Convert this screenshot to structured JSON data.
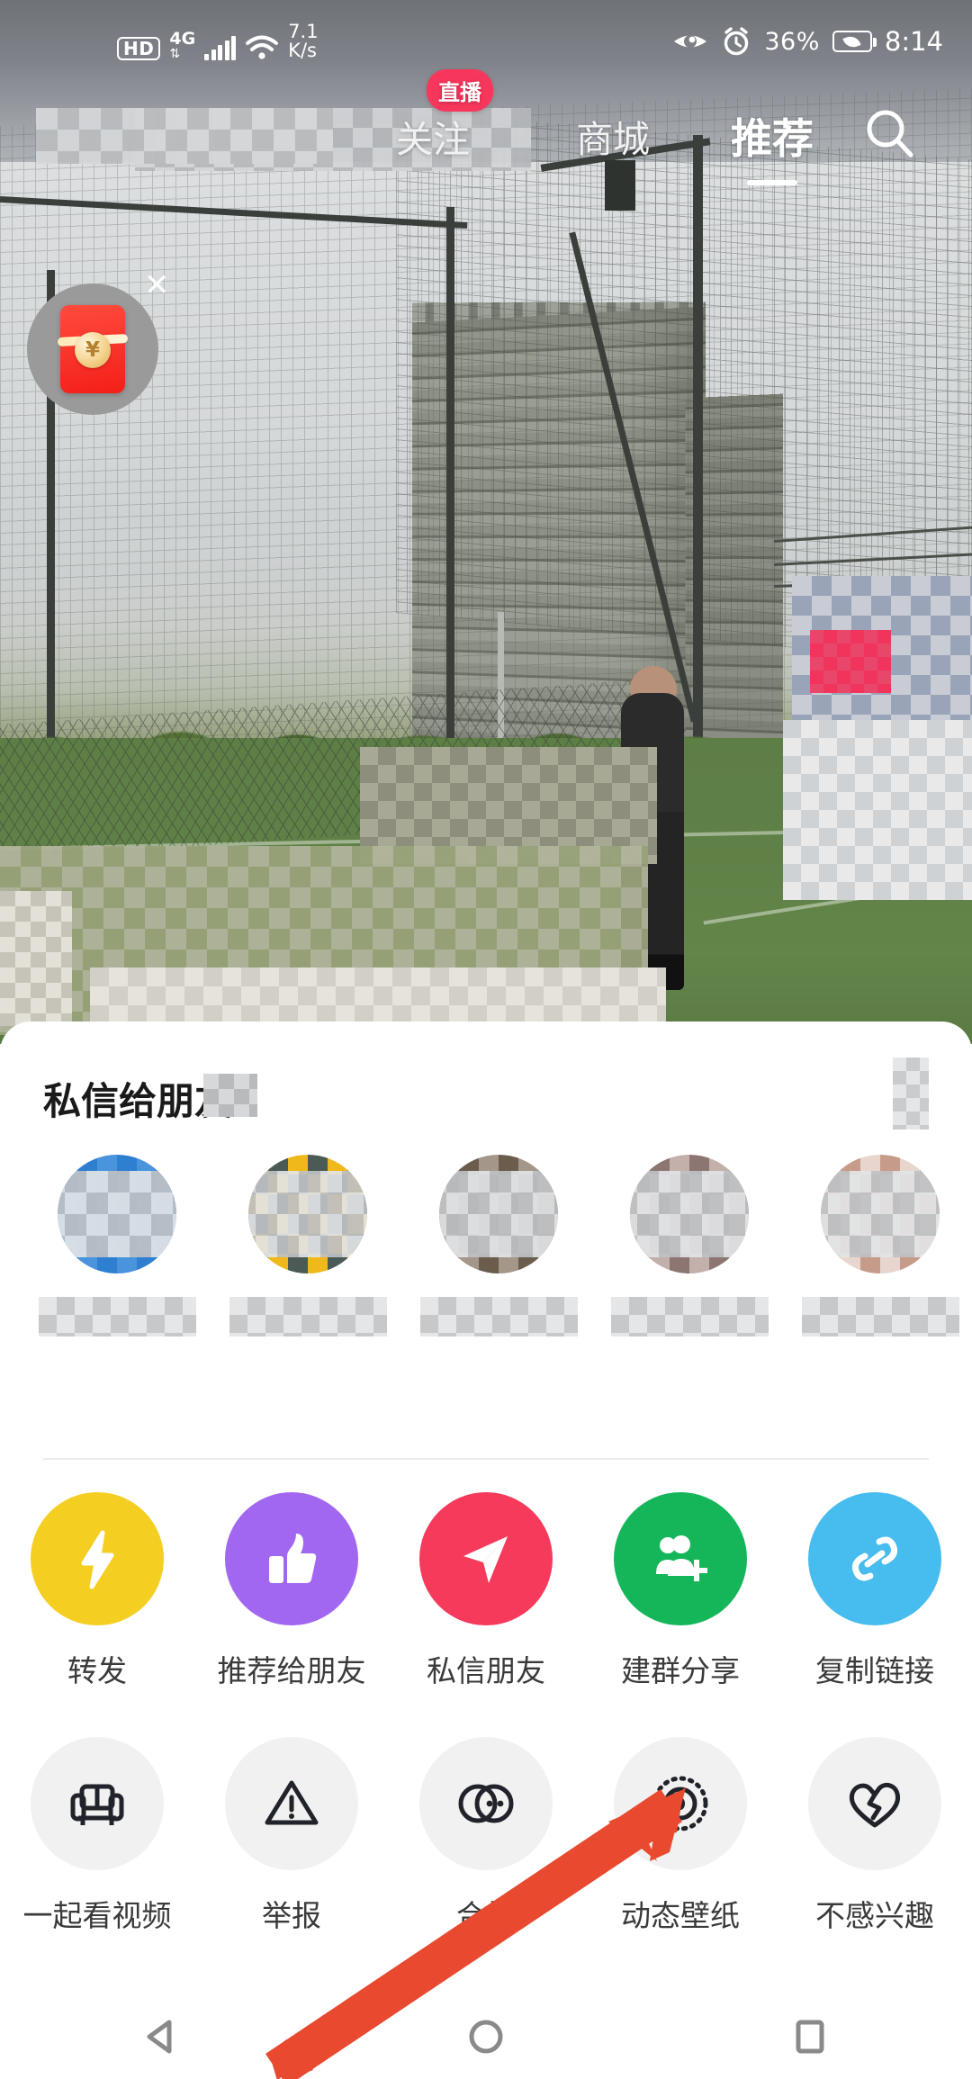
{
  "status_bar": {
    "hd": "HD",
    "network_type": "4G",
    "data_speed": "7.1",
    "data_speed_unit": "K/s",
    "battery_percent": "36%",
    "time": "8:14",
    "icons": [
      "eye-care-icon",
      "alarm-clock-icon",
      "battery-power-saving-icon"
    ]
  },
  "top_nav": {
    "tabs": [
      {
        "label": "关注",
        "active": false,
        "badge": "直播"
      },
      {
        "label": "商城",
        "active": false,
        "badge": ""
      },
      {
        "label": "推荐",
        "active": true,
        "badge": ""
      }
    ],
    "search_icon": "search-icon"
  },
  "floating": {
    "red_packet_icon": "red-envelope-icon",
    "red_packet_symbol": "¥",
    "close_label": "✕"
  },
  "share_sheet": {
    "title": "私信给朋友",
    "friends": [
      {
        "name": "",
        "avatar": "friend-avatar-1"
      },
      {
        "name": "",
        "avatar": "friend-avatar-2"
      },
      {
        "name": "",
        "avatar": "friend-avatar-3"
      },
      {
        "name": "",
        "avatar": "friend-avatar-4"
      },
      {
        "name": "",
        "avatar": "friend-avatar-5"
      }
    ],
    "actions_row1": [
      {
        "label": "转发",
        "icon": "lightning-bolt-icon",
        "color": "#F5CE22"
      },
      {
        "label": "推荐给朋友",
        "icon": "thumbs-up-icon",
        "color": "#A267F0"
      },
      {
        "label": "私信朋友",
        "icon": "paper-plane-icon",
        "color": "#F53A5C"
      },
      {
        "label": "建群分享",
        "icon": "add-user-group-icon",
        "color": "#15B65A"
      },
      {
        "label": "复制链接",
        "icon": "link-chain-icon",
        "color": "#47BCEE"
      }
    ],
    "actions_row2": [
      {
        "label": "一起看视频",
        "icon": "sofa-icon",
        "color": "#F1F1F1"
      },
      {
        "label": "举报",
        "icon": "warning-triangle-icon",
        "color": "#F1F1F1"
      },
      {
        "label": "合拍",
        "icon": "duet-circles-icon",
        "color": "#F1F1F1"
      },
      {
        "label": "动态壁纸",
        "icon": "dotted-target-icon",
        "color": "#F1F1F1"
      },
      {
        "label": "不感兴趣",
        "icon": "broken-heart-icon",
        "color": "#F1F1F1"
      }
    ]
  },
  "annotation": {
    "arrow_color": "#E8492F",
    "points_at": "动态壁纸"
  },
  "system_nav": {
    "back_icon": "back-triangle-icon",
    "home_icon": "home-circle-icon",
    "recents_icon": "recents-square-icon"
  }
}
